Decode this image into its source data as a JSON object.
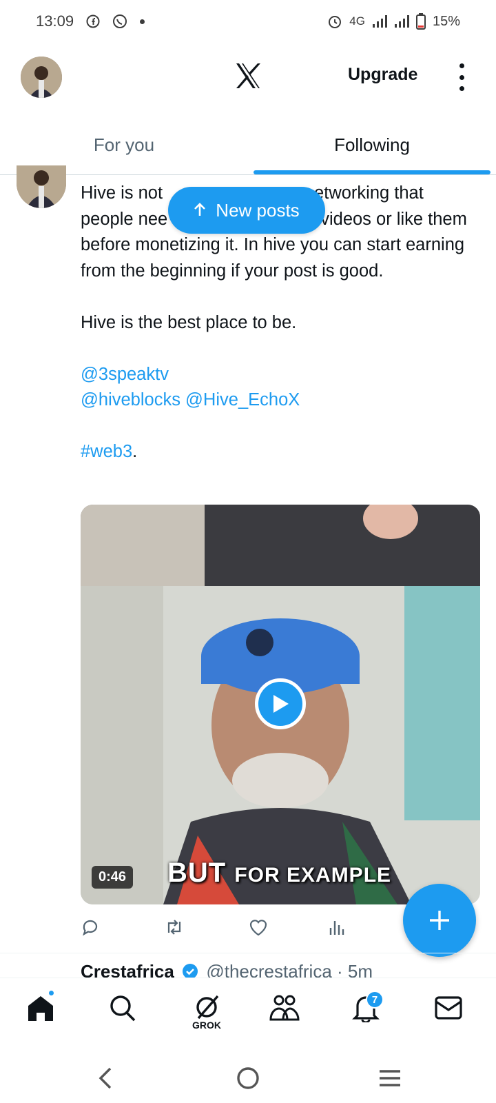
{
  "status_bar": {
    "time": "13:09",
    "network": "4G",
    "battery": "15%"
  },
  "header": {
    "upgrade_label": "Upgrade"
  },
  "tabs": [
    {
      "label": "For you",
      "active": false
    },
    {
      "label": "Following",
      "active": true
    }
  ],
  "new_posts_label": "New posts",
  "post": {
    "text_line1_before": "Hive is not",
    "text_line1_after": "etworking that",
    "text_line2_before": "people nee",
    "text_line2_after": "videos or like them",
    "text_rest": "before monetizing it. In hive you can start earning from the beginning if your post is good.",
    "text_para2": "Hive is the best place to be.",
    "mention1": "@3speaktv",
    "mention2": "@hiveblocks",
    "mention3": "@Hive_EchoX",
    "hashtag": "#web3",
    "hashtag_suffix": ".",
    "video": {
      "duration": "0:46",
      "caption_big": "BUT",
      "caption_small": "FOR EXAMPLE"
    }
  },
  "next_post": {
    "name": "Crestafrica",
    "handle": "@thecrestafrica · 5m"
  },
  "bottom_nav": {
    "grok_label": "GROK",
    "notifications_count": "7"
  },
  "colors": {
    "accent": "#1d9bf0",
    "text": "#0f1419",
    "secondary": "#536471"
  }
}
